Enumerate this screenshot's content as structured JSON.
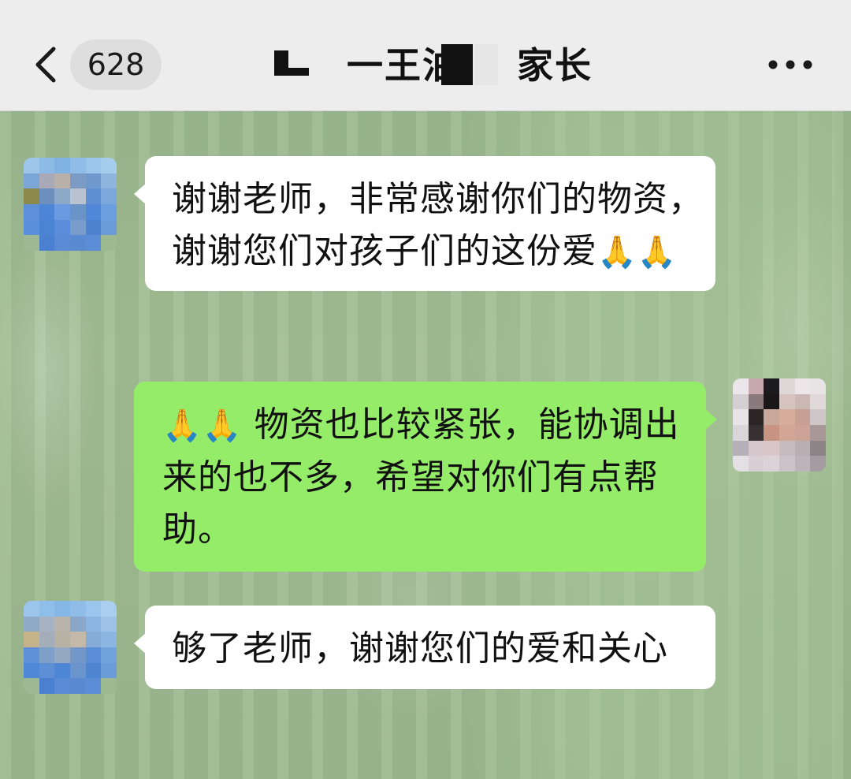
{
  "header": {
    "unread_count": "628",
    "title": "一王泊",
    "title_suffix": "家长",
    "back_icon": "chevron-left-icon",
    "more_icon": "more-horizontal-icon"
  },
  "messages": [
    {
      "side": "left",
      "text": "谢谢老师，非常感谢你们的物资，谢谢您们对孩子们的这份爱",
      "emoji": "🙏🙏"
    },
    {
      "side": "right",
      "emoji": "🙏🙏",
      "text": " 物资也比较紧张，能协调出来的也不多，希望对你们有点帮助。"
    },
    {
      "side": "left",
      "text": "够了老师，谢谢您们的爱和关心"
    }
  ],
  "colors": {
    "header_bg": "#ededed",
    "white_bubble": "#ffffff",
    "green_bubble": "#95ec69",
    "wallpaper": "#9db98f"
  }
}
